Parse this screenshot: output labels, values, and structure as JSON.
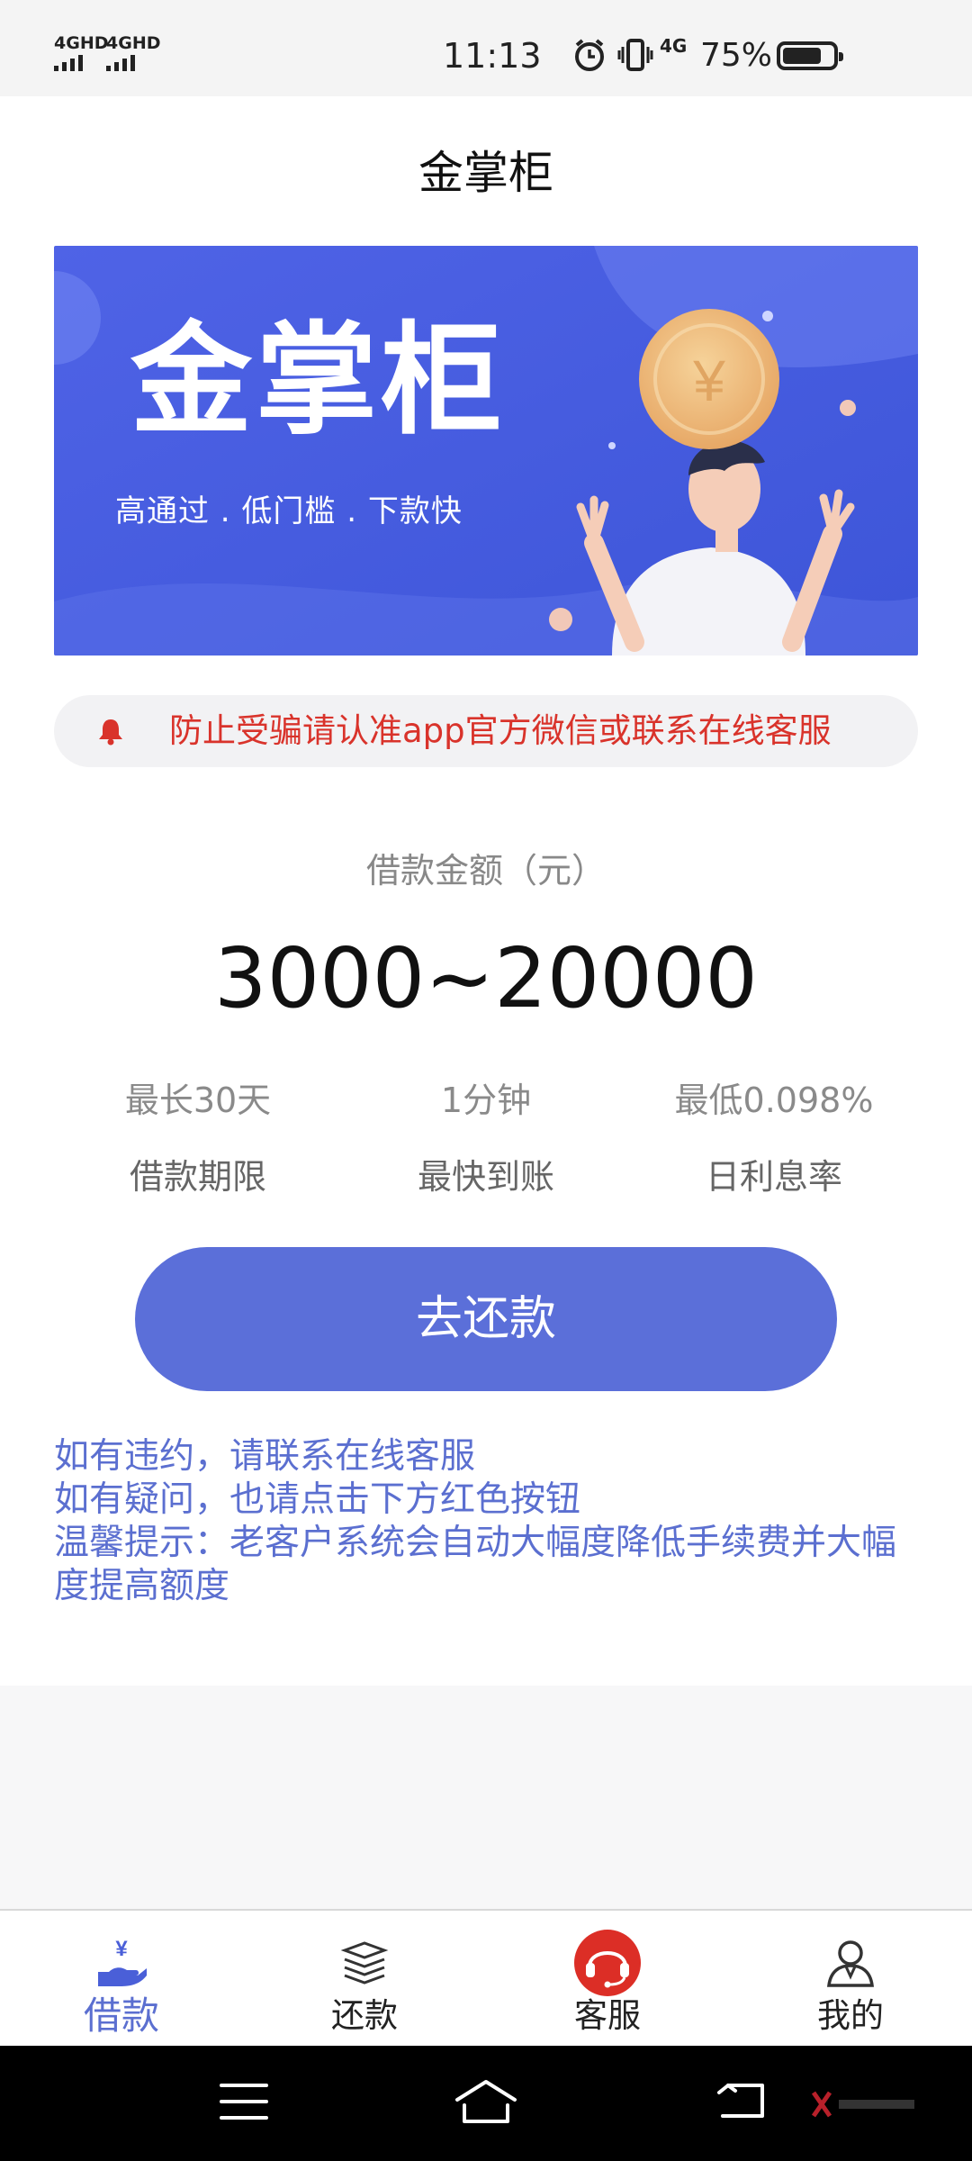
{
  "status_bar": {
    "sim1": "4GHD",
    "sim2": "4GHD",
    "time": "11:13",
    "net": "4G",
    "battery": "75%"
  },
  "header": {
    "title": "金掌柜"
  },
  "banner": {
    "title": "金掌柜",
    "subtitle": "高通过 . 低门槛 . 下款快"
  },
  "notice": {
    "text": "防止受骗请认准app官方微信或联系在线客服"
  },
  "loan": {
    "amount_label": "借款金额（元）",
    "amount_value": "3000~20000",
    "stats": [
      {
        "value": "最长30天",
        "label": "借款期限"
      },
      {
        "value": "1分钟",
        "label": "最快到账"
      },
      {
        "value": "最低0.098%",
        "label": "日利息率"
      }
    ],
    "button": "去还款"
  },
  "tips": [
    "如有违约，请联系在线客服",
    "如有疑问，也请点击下方红色按钮",
    "温馨提示：老客户系统会自动大幅度降低手续费并大幅度提高额度"
  ],
  "tabs": [
    {
      "label": "借款",
      "icon": "loan-hand-icon",
      "active": true
    },
    {
      "label": "还款",
      "icon": "repay-stack-icon",
      "active": false
    },
    {
      "label": "客服",
      "icon": "headset-icon",
      "active": false
    },
    {
      "label": "我的",
      "icon": "user-icon",
      "active": false
    }
  ],
  "colors": {
    "accent": "#5b6fd9",
    "notice_red": "#d9332b",
    "service_red": "#dc2e26",
    "banner_blue": "#4a5fe0"
  }
}
